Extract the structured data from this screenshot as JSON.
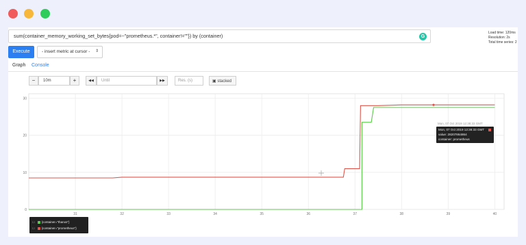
{
  "query": {
    "expression": "sum(container_memory_working_set_bytes{pod=~\"prometheus.*\", container!=\"\"}) by (container)",
    "icon": "grammarly-icon"
  },
  "stats": {
    "load_time": "Load time: 120ms",
    "resolution": "Resolution: 2s",
    "total_series": "Total time series: 2"
  },
  "toolbar": {
    "execute_label": "Execute",
    "insert_metric_label": "- insert metric at cursor -"
  },
  "tabs": {
    "graph": "Graph",
    "console": "Console"
  },
  "controls": {
    "range_minus": "−",
    "range_value": "10m",
    "range_plus": "+",
    "back": "◀◀",
    "until_placeholder": "Until",
    "forward": "▶▶",
    "res_placeholder": "Res. (s)",
    "stacked_label": "stacked"
  },
  "tooltip": {
    "above": "Mon, 07 Oct 2019 12:38:33 GMT",
    "time": "Mon, 07 Oct 2019 12:38:33 GMT",
    "value": "value: 28207864864",
    "label": "container: prometheus"
  },
  "legend": [
    {
      "label": "{container=\"thanos\"}",
      "color": "#5cc94c"
    },
    {
      "label": "{container=\"prometheus\"}",
      "color": "#e0544b"
    }
  ],
  "chart_data": {
    "type": "line",
    "x_ticks": [
      "31",
      "32",
      "33",
      "34",
      "35",
      "36",
      "37",
      "38",
      "39",
      "40"
    ],
    "y_ticks": [
      "0",
      "10",
      "20",
      "30"
    ],
    "ylim": [
      0,
      30
    ],
    "series": [
      {
        "name": "{container=\"thanos\"}",
        "color": "#5cc94c",
        "x": [
          30.0,
          37.15,
          37.15,
          37.2,
          37.3,
          37.35,
          37.4,
          37.45,
          37.55,
          37.6,
          38.0,
          40.0
        ],
        "y": [
          0.0,
          0.0,
          23.5,
          23.5,
          23.5,
          23.5,
          27.5,
          27.5,
          27.5,
          27.5,
          27.5,
          27.5
        ]
      },
      {
        "name": "{container=\"prometheus\"}",
        "color": "#e0544b",
        "x": [
          30.0,
          31.8,
          32.0,
          36.75,
          36.78,
          37.1,
          37.12,
          37.15,
          37.2,
          37.5,
          38.0,
          40.0
        ],
        "y": [
          8.5,
          8.5,
          8.7,
          8.7,
          11.0,
          11.0,
          28.0,
          28.0,
          28.0,
          28.0,
          28.2,
          28.2
        ]
      }
    ]
  }
}
